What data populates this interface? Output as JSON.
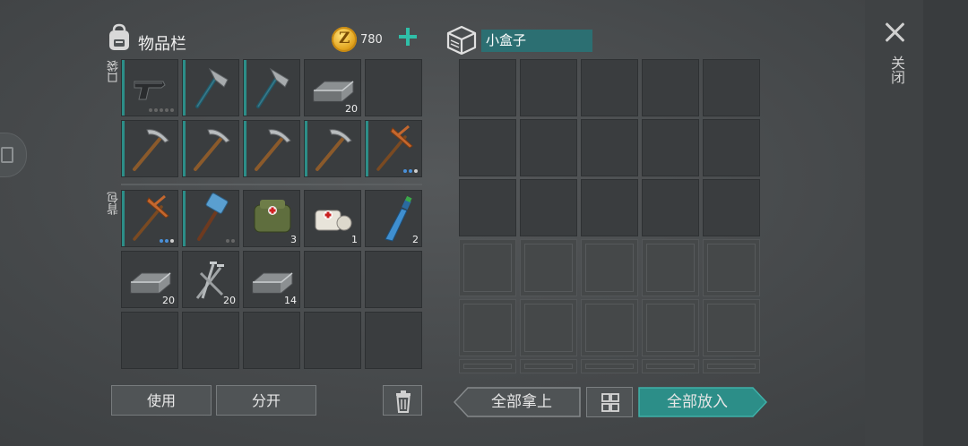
{
  "inventory": {
    "title": "物品栏",
    "coins": "780",
    "pocket_label": "口袋",
    "backpack_label": "背包",
    "pocket": [
      {
        "icon": "pistol-icon",
        "count": "",
        "bar": true,
        "dots": "ddddd"
      },
      {
        "icon": "hatchet-icon",
        "count": "",
        "bar": true,
        "dots": ""
      },
      {
        "icon": "hatchet-icon",
        "count": "",
        "bar": true,
        "dots": ""
      },
      {
        "icon": "iron-bar-icon",
        "count": "20",
        "bar": false,
        "dots": ""
      },
      {
        "icon": "",
        "count": "",
        "bar": false,
        "dots": ""
      },
      {
        "icon": "pickaxe-icon",
        "count": "",
        "bar": true,
        "dots": ""
      },
      {
        "icon": "pickaxe-icon",
        "count": "",
        "bar": true,
        "dots": ""
      },
      {
        "icon": "pickaxe-icon",
        "count": "",
        "bar": true,
        "dots": ""
      },
      {
        "icon": "pickaxe-icon",
        "count": "",
        "bar": true,
        "dots": ""
      },
      {
        "icon": "copper-pickaxe-icon",
        "count": "",
        "bar": true,
        "dots": "bbw"
      }
    ],
    "backpack": [
      {
        "icon": "copper-pickaxe-icon",
        "count": "",
        "bar": true,
        "dots": "bbw"
      },
      {
        "icon": "sledgehammer-icon",
        "count": "",
        "bar": true,
        "dots": "dd"
      },
      {
        "icon": "medkit-icon",
        "count": "3",
        "bar": false,
        "dots": ""
      },
      {
        "icon": "bandage-icon",
        "count": "1",
        "bar": false,
        "dots": ""
      },
      {
        "icon": "water-bottle-icon",
        "count": "2",
        "bar": false,
        "dots": ""
      },
      {
        "icon": "iron-bar-icon",
        "count": "20",
        "bar": false,
        "dots": ""
      },
      {
        "icon": "nails-icon",
        "count": "20",
        "bar": false,
        "dots": ""
      },
      {
        "icon": "iron-bar-icon",
        "count": "14",
        "bar": false,
        "dots": ""
      },
      {
        "icon": "",
        "count": "",
        "bar": false,
        "dots": ""
      },
      {
        "icon": "",
        "count": "",
        "bar": false,
        "dots": ""
      },
      {
        "icon": "",
        "count": "",
        "bar": false,
        "dots": ""
      },
      {
        "icon": "",
        "count": "",
        "bar": false,
        "dots": ""
      },
      {
        "icon": "",
        "count": "",
        "bar": false,
        "dots": ""
      },
      {
        "icon": "",
        "count": "",
        "bar": false,
        "dots": ""
      },
      {
        "icon": "",
        "count": "",
        "bar": false,
        "dots": ""
      }
    ],
    "use_label": "使用",
    "split_label": "分开"
  },
  "container": {
    "name": "小盒子",
    "unlocked_rows": 3,
    "total_rows": 6,
    "take_all_label": "全部拿上",
    "put_all_label": "全部放入"
  },
  "close_label": "关闭",
  "colors": {
    "accent": "#2c8e88",
    "name_bg": "#2c6f72",
    "coin": "#e3a51f",
    "plus": "#2fbfa8"
  }
}
